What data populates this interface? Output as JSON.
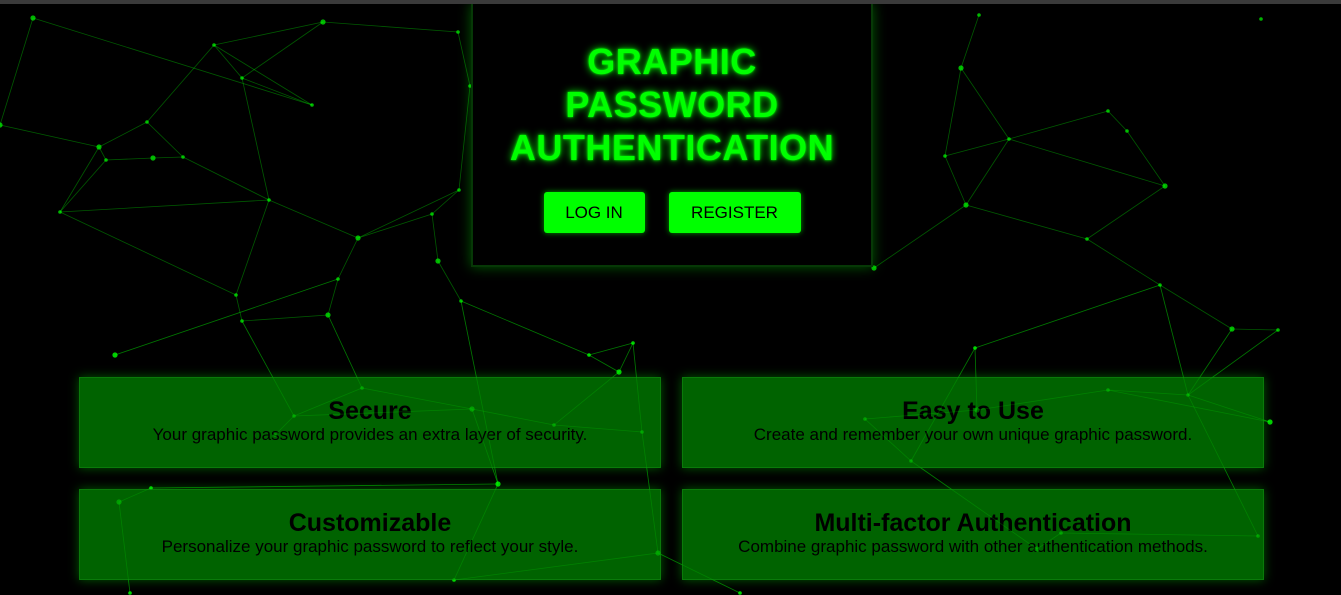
{
  "hero": {
    "title_line1": "GRAPHIC",
    "title_line2": "PASSWORD",
    "title_line3": "AUTHENTICATION",
    "login_label": "LOG IN",
    "register_label": "REGISTER"
  },
  "features": [
    {
      "title": "Secure",
      "description": "Your graphic password provides an extra layer of security."
    },
    {
      "title": "Easy to Use",
      "description": "Create and remember your own unique graphic password."
    },
    {
      "title": "Customizable",
      "description": "Personalize your graphic password to reflect your style."
    },
    {
      "title": "Multi-factor Authentication",
      "description": "Combine graphic password with other authentication methods."
    }
  ],
  "colors": {
    "accent": "#00ff00",
    "background": "#000000",
    "card": "#006600"
  }
}
